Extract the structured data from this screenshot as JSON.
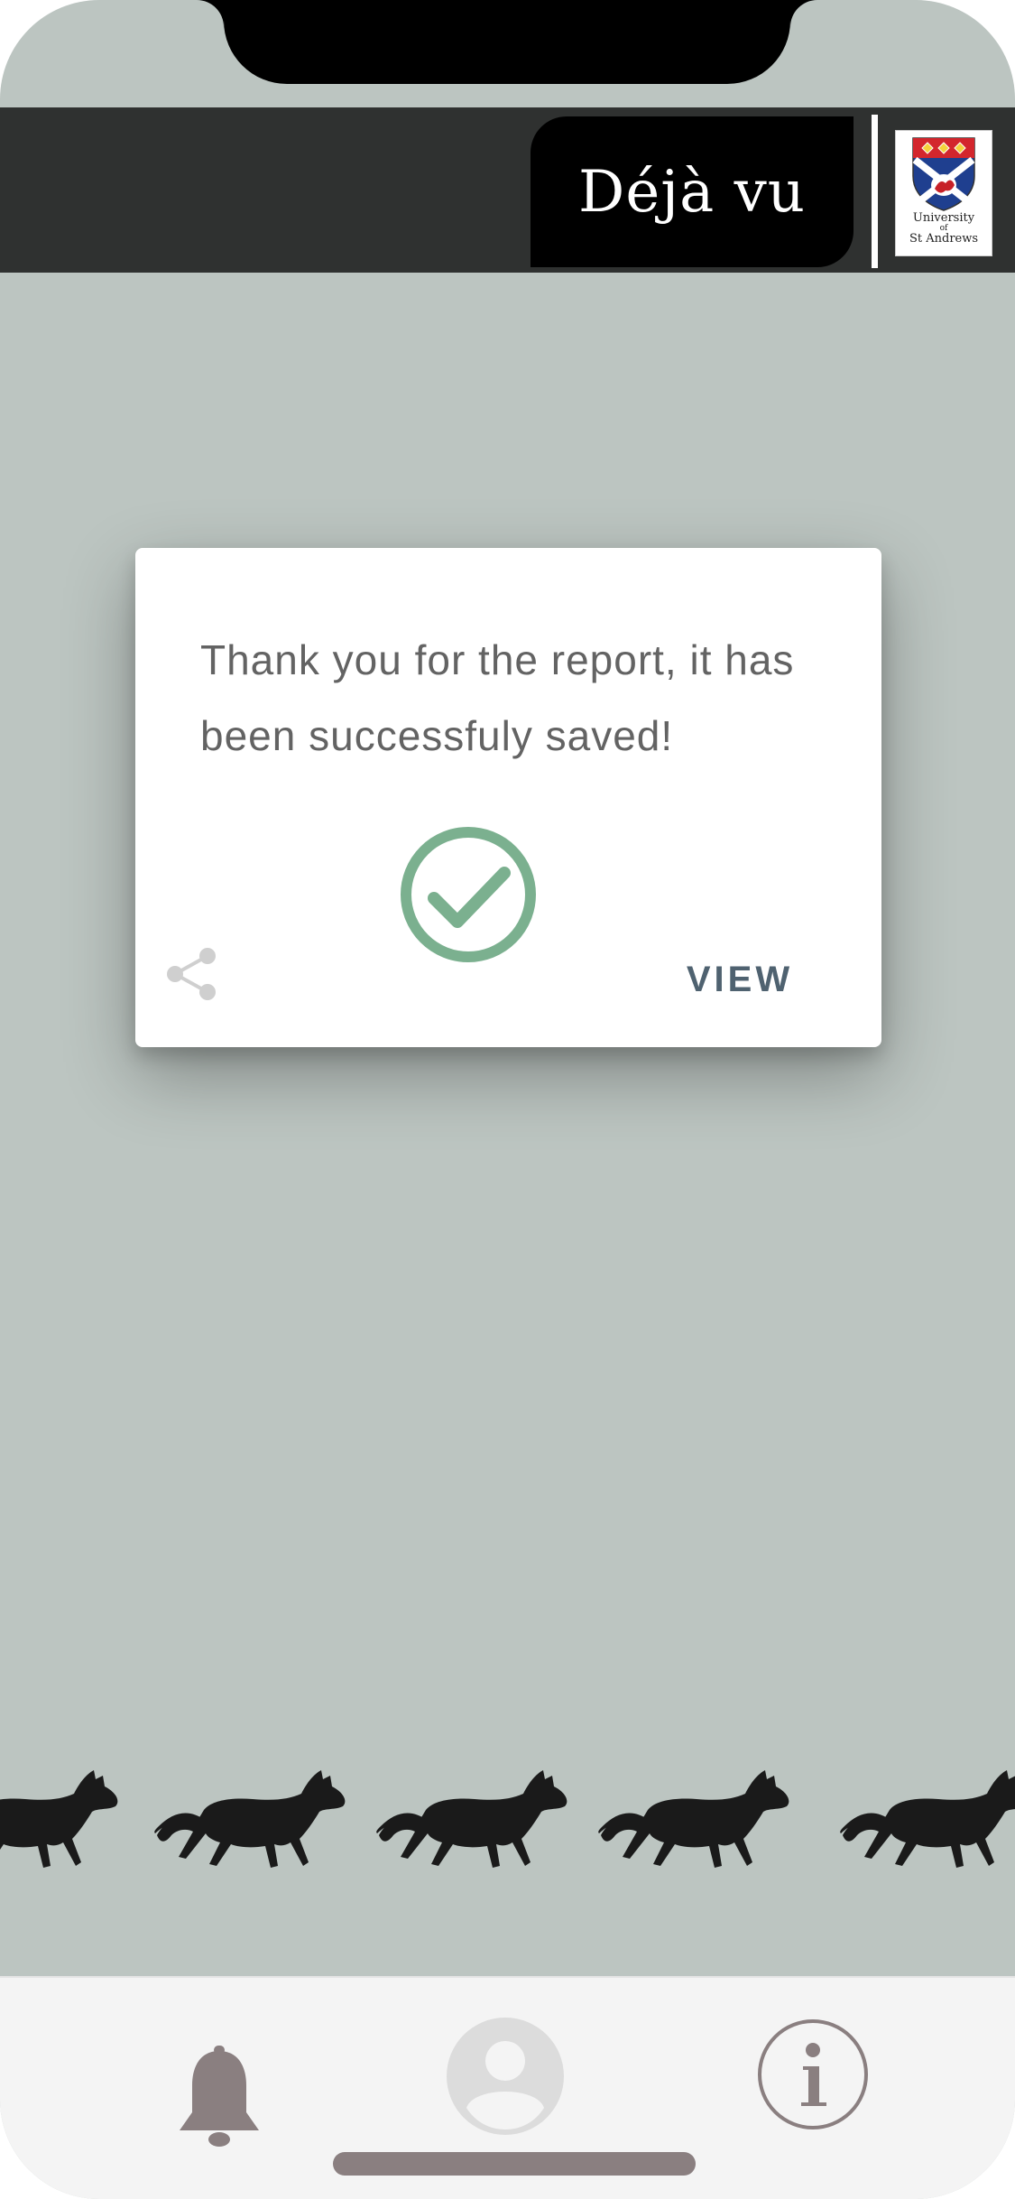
{
  "header": {
    "app_title": "Déjà vu",
    "logo": {
      "line1": "University",
      "line2": "of",
      "line3": "St Andrews",
      "icon": "st-andrews-crest"
    }
  },
  "dialog": {
    "message": "Thank you for the report, it has been successfuly saved!",
    "status_icon": "check-circle-icon",
    "share_icon": "share-icon",
    "view_label": "VIEW"
  },
  "decoration": {
    "cats_icon": "walking-cat-icon",
    "cat_count": 5
  },
  "tabs": [
    {
      "name": "notifications",
      "icon": "bell-icon"
    },
    {
      "name": "profile",
      "icon": "user-avatar-icon"
    },
    {
      "name": "info",
      "icon": "info-icon"
    }
  ],
  "colors": {
    "background": "#bcc5c1",
    "header": "#2f3130",
    "check_green": "#7bb08f",
    "view_text": "#4f6270",
    "tab_icon": "#8a7f80"
  }
}
